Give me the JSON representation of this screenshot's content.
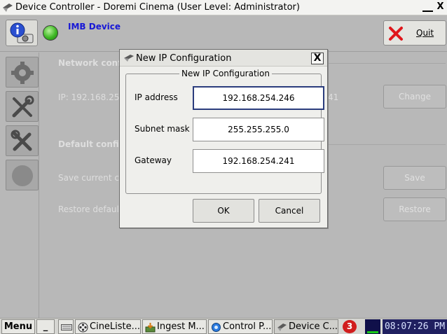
{
  "window": {
    "title": "Device Controller - Doremi Cinema (User Level: Administrator)",
    "minimize_label": "_",
    "close_label": "X"
  },
  "header": {
    "device_name": "IMB Device",
    "quit_label": "Quit",
    "status_color": "#3eb824"
  },
  "sidebar": {
    "items": [
      {
        "icon": "gear-icon"
      },
      {
        "icon": "tools-icon"
      },
      {
        "icon": "wrench-screwdriver-icon"
      },
      {
        "icon": "circle-icon"
      }
    ]
  },
  "main": {
    "network_section": "Network confi",
    "ip_text": "IP: 192.168.254",
    "ip_suffix": "41",
    "change_label": "Change",
    "default_section": "Default configu",
    "save_text": "Save current co",
    "save_label": "Save",
    "restore_text": "Restore default",
    "restore_label": "Restore"
  },
  "dialog": {
    "title": "New IP Configuration",
    "group_title": "New IP Configuration",
    "close_label": "X",
    "fields": {
      "ip_label": "IP address",
      "ip_value": "192.168.254.246",
      "subnet_label": "Subnet mask",
      "subnet_value": "255.255.255.0",
      "gateway_label": "Gateway",
      "gateway_value": "192.168.254.241"
    },
    "ok_label": "OK",
    "cancel_label": "Cancel"
  },
  "taskbar": {
    "menu_label": "Menu",
    "show_desktop_label": "_",
    "tasks": [
      {
        "label": "CineListe...",
        "icon": "film-reel-icon"
      },
      {
        "label": "Ingest M...",
        "icon": "ingest-icon"
      },
      {
        "label": "Control P...",
        "icon": "control-panel-icon"
      },
      {
        "label": "Device C...",
        "icon": "device-controller-icon"
      }
    ],
    "notification_count": "3",
    "clock": "08:07:26 PM"
  },
  "colors": {
    "accent_text": "#1818d6",
    "quit_x": "#e0161b",
    "focus_border": "#2b3d7d",
    "clock_bg": "#202060"
  }
}
